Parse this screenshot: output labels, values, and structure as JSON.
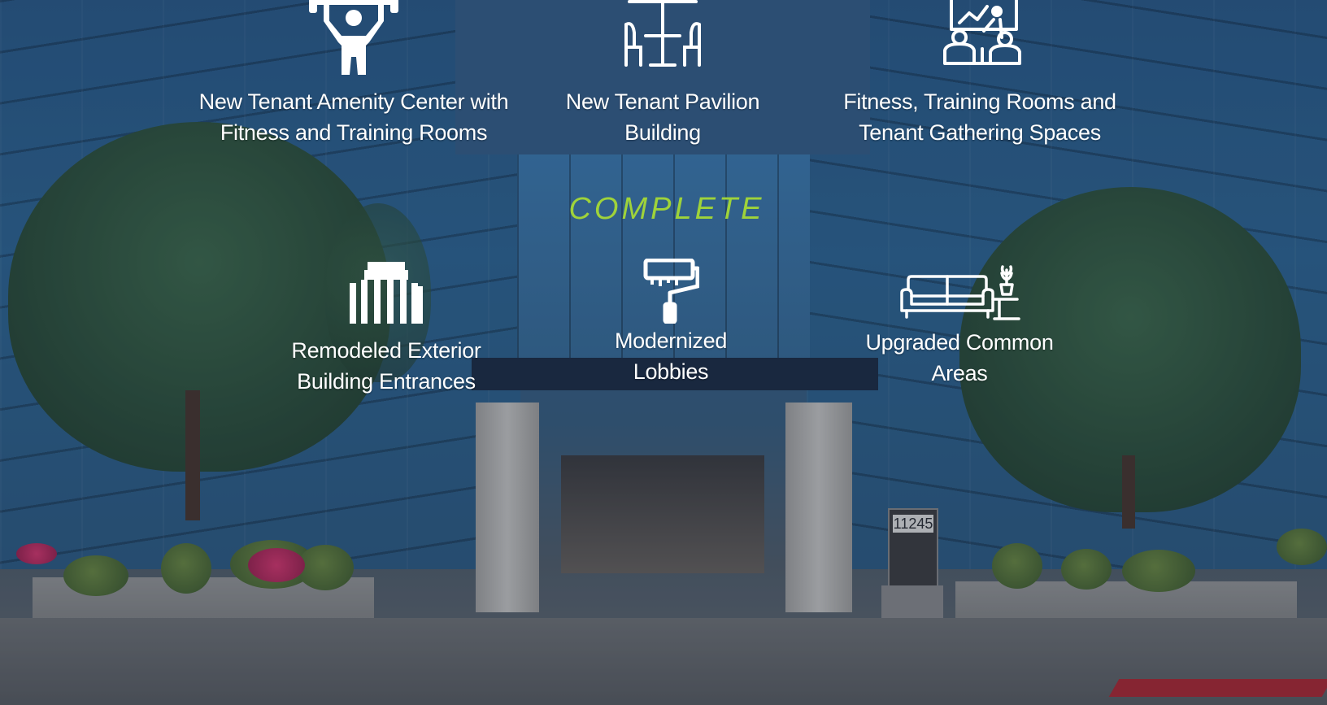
{
  "colors": {
    "heading": "#9fd33a",
    "text": "#ffffff"
  },
  "heading": "COMPLETE",
  "features_top": [
    {
      "icon": "weightlifter-icon",
      "label": "New Tenant Amenity Center with\nFitness and Training Rooms"
    },
    {
      "icon": "patio-table-icon",
      "label": "New Tenant Pavilion\nBuilding"
    },
    {
      "icon": "presentation-meeting-icon",
      "label": "Fitness, Training Rooms and\nTenant Gathering Spaces"
    }
  ],
  "features_bottom": [
    {
      "icon": "building-facade-icon",
      "label": "Remodeled Exterior\nBuilding Entrances"
    },
    {
      "icon": "paint-roller-icon",
      "label": "Modernized\nLobbies"
    },
    {
      "icon": "sofa-lamp-icon",
      "label": "Upgraded Common\nAreas"
    }
  ],
  "sign": {
    "number": "11245"
  }
}
